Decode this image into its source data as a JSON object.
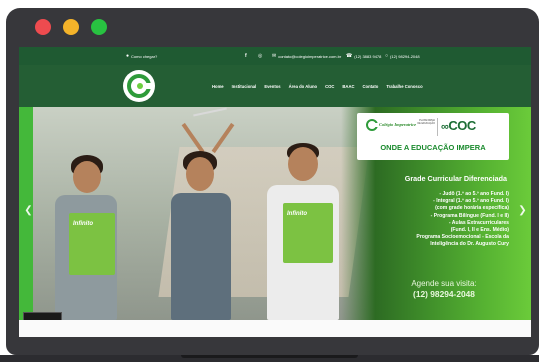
{
  "window": {
    "colors": {
      "frame": "#37373b",
      "close": "#ee4b4f",
      "minimize": "#f4b32a",
      "maximize": "#28c241"
    }
  },
  "topbar": {
    "location": "Como chegar?",
    "social_icons": [
      "facebook-icon",
      "instagram-icon"
    ],
    "email": "contato@colegioimperatrice.com.br",
    "phone": "(12) 3883 9478",
    "whatsapp": "(12) 98294-2048",
    "color": "#1f5a32"
  },
  "navbar": {
    "color": "#245e34",
    "items": [
      "Home",
      "Institucional",
      "Eventos",
      "Área do Aluno",
      "COC",
      "BAAC",
      "Contato",
      "Trabalhe Conosco"
    ]
  },
  "hero": {
    "brand": {
      "school_name": "Colégio Imperatrice",
      "platform": "PLATAFORMA DE EDUCAÇÃO",
      "partner": "COC",
      "tagline": "ONDE A EDUCAÇÃO IMPERA"
    },
    "heading": "Grade Curricular Diferenciada",
    "bullets": [
      "- Judô (1.º ao 5.º ano Fund. I)",
      "- Integral (1.º ao 5.º ano Fund. I)",
      "(com grade horária específica)",
      "- Programa Bilíngue (Fund. I e II)",
      "- Aulas Extracurriculares",
      "(Fund. I, II e Ens. Médio)",
      "Programa Socioemocional - Escola da",
      "Inteligência do Dr. Augusto Cury"
    ],
    "cta": "Agende sua visita:",
    "cta_phone": "(12) 98294-2048",
    "book_label": "Infinito",
    "accent": "#56b232"
  }
}
